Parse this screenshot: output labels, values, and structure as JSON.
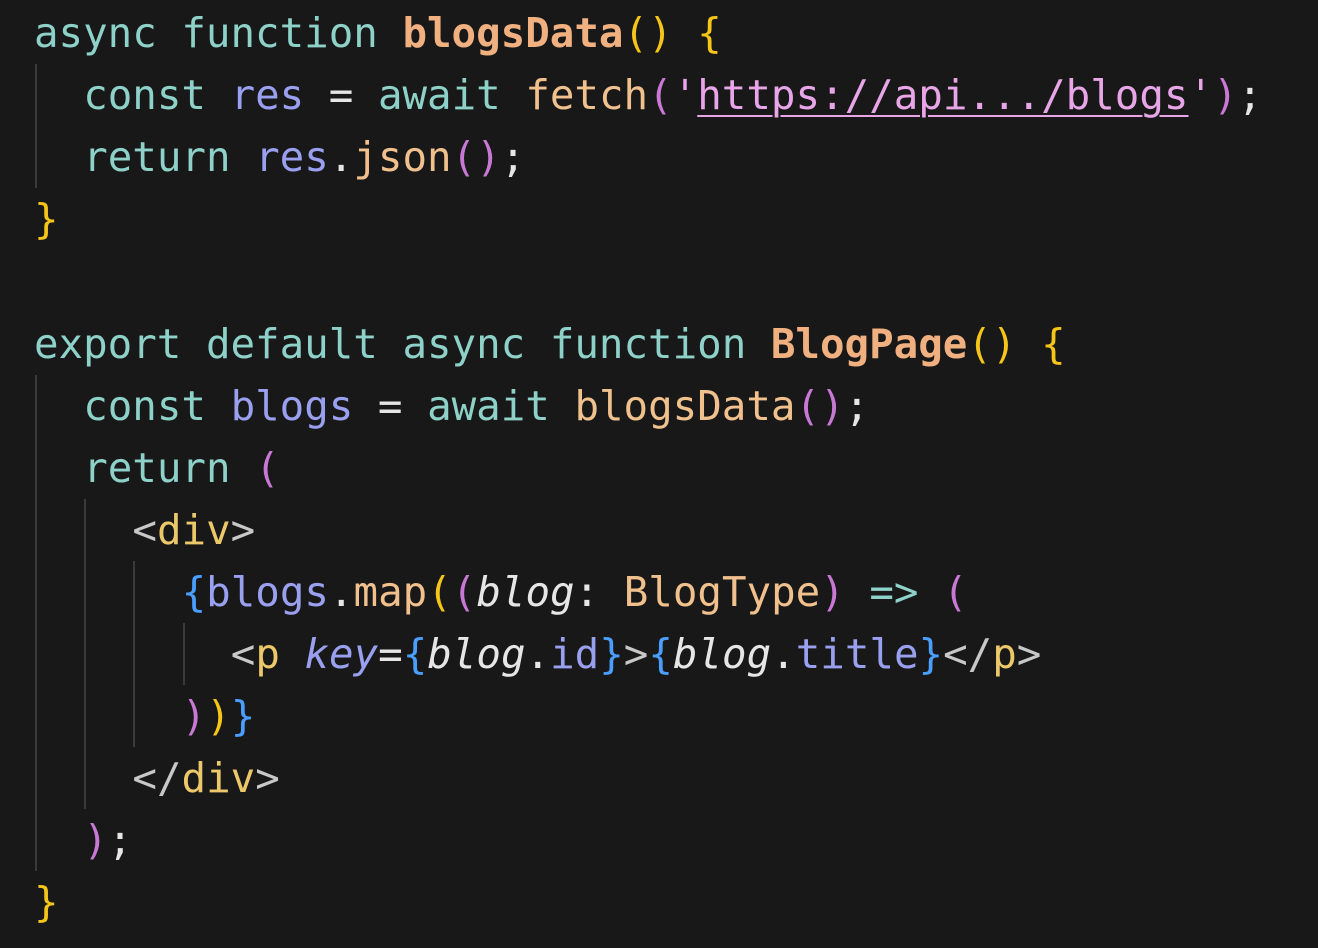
{
  "editor": {
    "theme": {
      "background": "#181818",
      "keyword": "#8dd1c9",
      "function": "#f0c08d",
      "variable": "#9aa0f0",
      "bracket_yellow": "#f5c518",
      "bracket_purple": "#c978d6",
      "bracket_blue": "#4a9eff",
      "string": "#e8a6e8",
      "punctuation": "#e6e6e6",
      "tag_angle": "#c8c8c8",
      "tag_name": "#ecc86a",
      "guide": "#3a3a3a"
    },
    "lines": [
      {
        "indent": 0,
        "tokens": [
          {
            "text": "async",
            "color": "#8dd1c9"
          },
          {
            "text": " ",
            "color": "#e6e6e6"
          },
          {
            "text": "function",
            "color": "#8dd1c9"
          },
          {
            "text": " ",
            "color": "#e6e6e6"
          },
          {
            "text": "blogsData",
            "color": "#f0b080",
            "style": "bold"
          },
          {
            "text": "()",
            "color": "#f5c518"
          },
          {
            "text": " ",
            "color": "#e6e6e6"
          },
          {
            "text": "{",
            "color": "#f5c518"
          }
        ]
      },
      {
        "indent": 1,
        "tokens": [
          {
            "text": "const",
            "color": "#8dd1c9"
          },
          {
            "text": " ",
            "color": "#e6e6e6"
          },
          {
            "text": "res",
            "color": "#9aa0f0"
          },
          {
            "text": " = ",
            "color": "#e6e6e6"
          },
          {
            "text": "await",
            "color": "#8dd1c9"
          },
          {
            "text": " ",
            "color": "#e6e6e6"
          },
          {
            "text": "fetch",
            "color": "#f0c08d"
          },
          {
            "text": "(",
            "color": "#c978d6"
          },
          {
            "text": "'",
            "color": "#e8a6e8"
          },
          {
            "text": "https://api.../blogs",
            "color": "#e8a6e8",
            "style": "underline"
          },
          {
            "text": "'",
            "color": "#e8a6e8"
          },
          {
            "text": ")",
            "color": "#c978d6"
          },
          {
            "text": ";",
            "color": "#e6e6e6"
          }
        ]
      },
      {
        "indent": 1,
        "tokens": [
          {
            "text": "return",
            "color": "#8dd1c9"
          },
          {
            "text": " ",
            "color": "#e6e6e6"
          },
          {
            "text": "res",
            "color": "#9aa0f0"
          },
          {
            "text": ".",
            "color": "#e6e6e6"
          },
          {
            "text": "json",
            "color": "#f0c08d"
          },
          {
            "text": "()",
            "color": "#c978d6"
          },
          {
            "text": ";",
            "color": "#e6e6e6"
          }
        ]
      },
      {
        "indent": 0,
        "tokens": [
          {
            "text": "}",
            "color": "#f5c518"
          }
        ]
      },
      {
        "indent": 0,
        "tokens": []
      },
      {
        "indent": 0,
        "tokens": [
          {
            "text": "export",
            "color": "#8dd1c9"
          },
          {
            "text": " ",
            "color": "#e6e6e6"
          },
          {
            "text": "default",
            "color": "#8dd1c9"
          },
          {
            "text": " ",
            "color": "#e6e6e6"
          },
          {
            "text": "async",
            "color": "#8dd1c9"
          },
          {
            "text": " ",
            "color": "#e6e6e6"
          },
          {
            "text": "function",
            "color": "#8dd1c9"
          },
          {
            "text": " ",
            "color": "#e6e6e6"
          },
          {
            "text": "BlogPage",
            "color": "#f0b080",
            "style": "bold"
          },
          {
            "text": "()",
            "color": "#f5c518"
          },
          {
            "text": " ",
            "color": "#e6e6e6"
          },
          {
            "text": "{",
            "color": "#f5c518"
          }
        ]
      },
      {
        "indent": 1,
        "tokens": [
          {
            "text": "const",
            "color": "#8dd1c9"
          },
          {
            "text": " ",
            "color": "#e6e6e6"
          },
          {
            "text": "blogs",
            "color": "#9aa0f0"
          },
          {
            "text": " = ",
            "color": "#e6e6e6"
          },
          {
            "text": "await",
            "color": "#8dd1c9"
          },
          {
            "text": " ",
            "color": "#e6e6e6"
          },
          {
            "text": "blogsData",
            "color": "#f0c08d"
          },
          {
            "text": "()",
            "color": "#c978d6"
          },
          {
            "text": ";",
            "color": "#e6e6e6"
          }
        ]
      },
      {
        "indent": 1,
        "tokens": [
          {
            "text": "return",
            "color": "#8dd1c9"
          },
          {
            "text": " ",
            "color": "#e6e6e6"
          },
          {
            "text": "(",
            "color": "#c978d6"
          }
        ]
      },
      {
        "indent": 2,
        "tokens": [
          {
            "text": "<",
            "color": "#c8c8c8"
          },
          {
            "text": "div",
            "color": "#ecc86a"
          },
          {
            "text": ">",
            "color": "#c8c8c8"
          }
        ]
      },
      {
        "indent": 3,
        "tokens": [
          {
            "text": "{",
            "color": "#4a9eff"
          },
          {
            "text": "blogs",
            "color": "#9aa0f0"
          },
          {
            "text": ".",
            "color": "#e6e6e6"
          },
          {
            "text": "map",
            "color": "#f0c08d"
          },
          {
            "text": "(",
            "color": "#f5c518"
          },
          {
            "text": "(",
            "color": "#c978d6"
          },
          {
            "text": "blog",
            "color": "#e6e6e6",
            "style": "italic"
          },
          {
            "text": ": ",
            "color": "#e6e6e6"
          },
          {
            "text": "BlogType",
            "color": "#f0c08d"
          },
          {
            "text": ")",
            "color": "#c978d6"
          },
          {
            "text": " ",
            "color": "#e6e6e6"
          },
          {
            "text": "=>",
            "color": "#8dd1c9"
          },
          {
            "text": " ",
            "color": "#e6e6e6"
          },
          {
            "text": "(",
            "color": "#c978d6"
          }
        ]
      },
      {
        "indent": 4,
        "tokens": [
          {
            "text": "<",
            "color": "#c8c8c8"
          },
          {
            "text": "p",
            "color": "#ecc86a"
          },
          {
            "text": " ",
            "color": "#e6e6e6"
          },
          {
            "text": "key",
            "color": "#9aa0f0",
            "style": "italic"
          },
          {
            "text": "=",
            "color": "#e6e6e6"
          },
          {
            "text": "{",
            "color": "#4a9eff"
          },
          {
            "text": "blog",
            "color": "#e6e6e6",
            "style": "italic"
          },
          {
            "text": ".",
            "color": "#e6e6e6"
          },
          {
            "text": "id",
            "color": "#9aa0f0"
          },
          {
            "text": "}",
            "color": "#4a9eff"
          },
          {
            "text": ">",
            "color": "#c8c8c8"
          },
          {
            "text": "{",
            "color": "#4a9eff"
          },
          {
            "text": "blog",
            "color": "#e6e6e6",
            "style": "italic"
          },
          {
            "text": ".",
            "color": "#e6e6e6"
          },
          {
            "text": "title",
            "color": "#9aa0f0"
          },
          {
            "text": "}",
            "color": "#4a9eff"
          },
          {
            "text": "</",
            "color": "#c8c8c8"
          },
          {
            "text": "p",
            "color": "#ecc86a"
          },
          {
            "text": ">",
            "color": "#c8c8c8"
          }
        ]
      },
      {
        "indent": 3,
        "tokens": [
          {
            "text": ")",
            "color": "#c978d6"
          },
          {
            "text": ")",
            "color": "#f5c518"
          },
          {
            "text": "}",
            "color": "#4a9eff"
          }
        ]
      },
      {
        "indent": 2,
        "tokens": [
          {
            "text": "</",
            "color": "#c8c8c8"
          },
          {
            "text": "div",
            "color": "#ecc86a"
          },
          {
            "text": ">",
            "color": "#c8c8c8"
          }
        ]
      },
      {
        "indent": 1,
        "tokens": [
          {
            "text": ")",
            "color": "#c978d6"
          },
          {
            "text": ";",
            "color": "#e6e6e6"
          }
        ]
      },
      {
        "indent": 0,
        "tokens": [
          {
            "text": "}",
            "color": "#f5c518"
          }
        ]
      }
    ]
  }
}
